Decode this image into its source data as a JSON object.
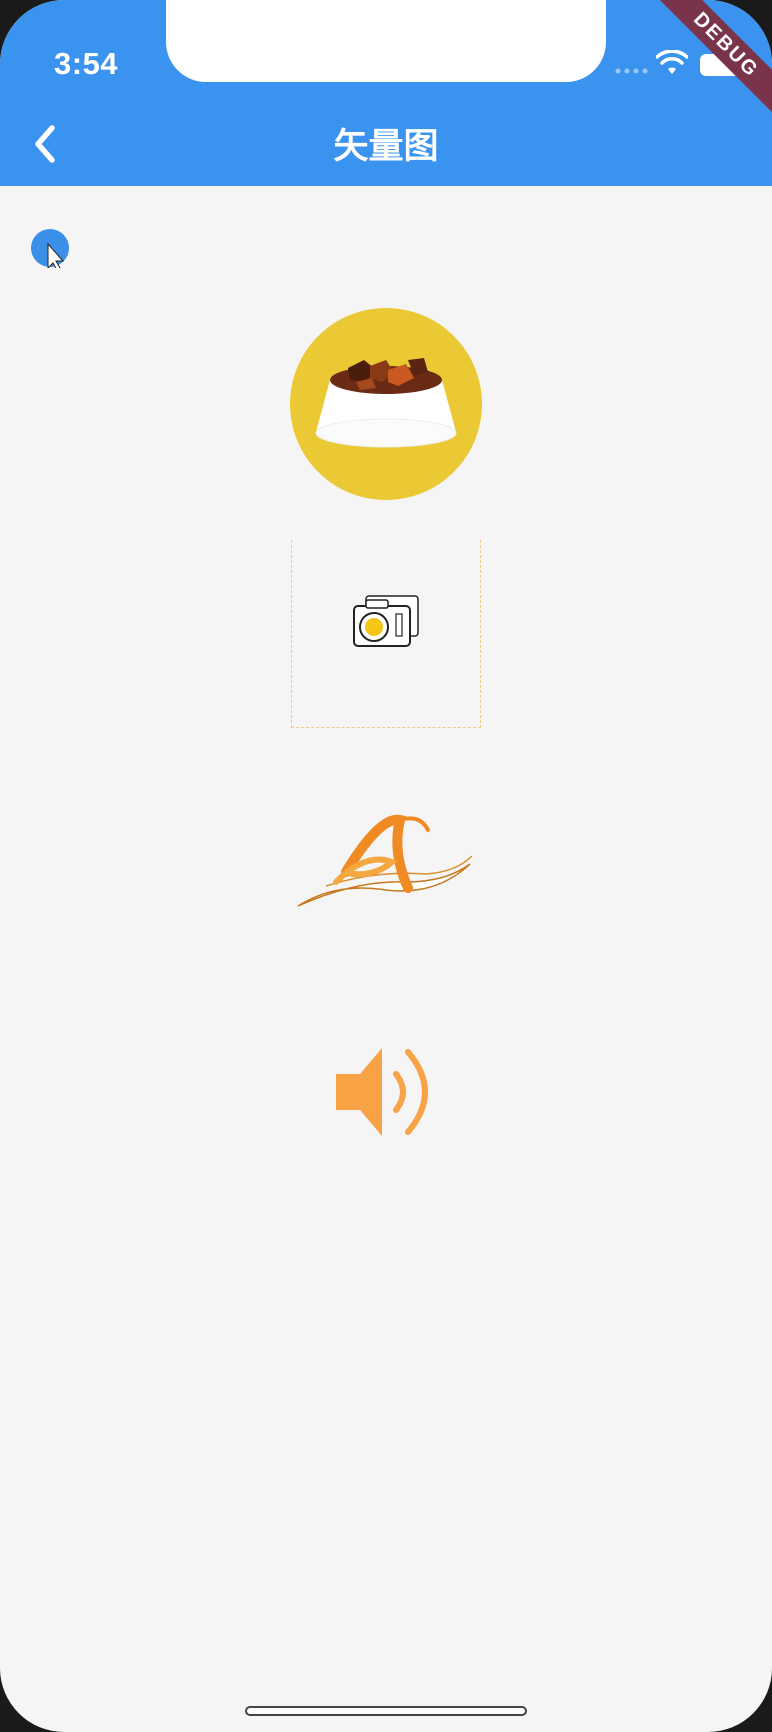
{
  "status_bar": {
    "time": "3:54",
    "debug_label": "DEBUG"
  },
  "app_bar": {
    "title": "矢量图",
    "back_icon": "chevron-left-icon"
  },
  "content": {
    "images": [
      {
        "name": "food-bowl-image",
        "icon": "pet-food-bowl"
      },
      {
        "name": "camera-icon",
        "icon": "camera"
      },
      {
        "name": "letter-a-logo",
        "icon": "letter-a-calligraphy"
      },
      {
        "name": "speaker-icon",
        "icon": "volume-speaker"
      }
    ]
  },
  "colors": {
    "app_bar": "#3a93ee",
    "background": "#f5f5f5",
    "bowl_circle": "#ebc935",
    "accent_orange": "#f9a347",
    "debug_ribbon": "#7a3449"
  }
}
